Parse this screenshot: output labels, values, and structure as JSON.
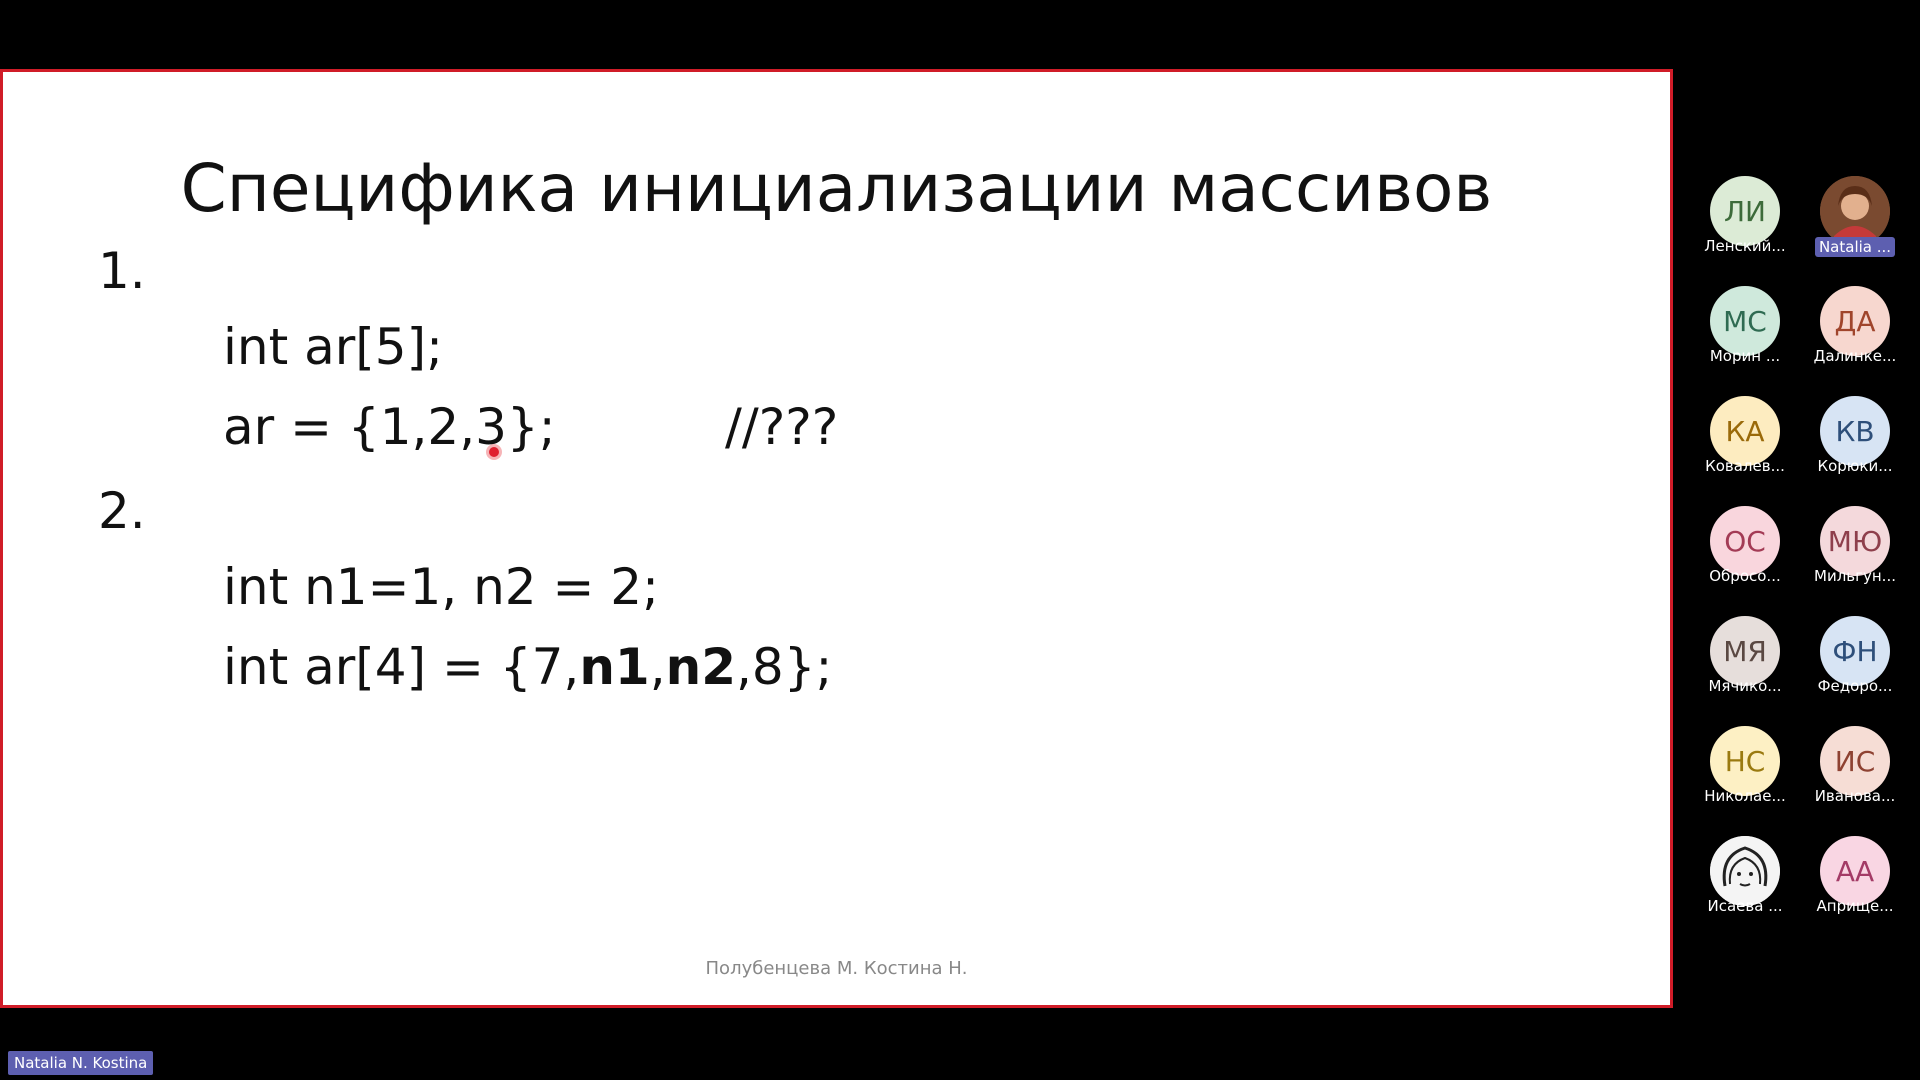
{
  "slide": {
    "title": "Специфика инициализации массивов",
    "item1_number": "1.",
    "item1_line1": "int ar[5];",
    "item1_line2": "ar = {1,2,3};",
    "item1_comment": "//???",
    "item2_number": "2.",
    "item2_line1": "int n1=1, n2 = 2;",
    "item2_line2_prefix": "int ar[4] = {7,",
    "item2_line2_bold1": "n1",
    "item2_line2_sep": ",",
    "item2_line2_bold2": "n2",
    "item2_line2_suffix": ",8};",
    "footer": "Полубенцева М. Костина Н."
  },
  "participants": [
    {
      "initials": "ЛИ",
      "name": "Ленский...",
      "bg": "#dcebd6",
      "fg": "#3d6b3a"
    },
    {
      "initials": "",
      "name": "Natalia ...",
      "bg": "#8a5a3c",
      "fg": "#ffffff",
      "photo": true,
      "active": true
    },
    {
      "initials": "МС",
      "name": "Морин ...",
      "bg": "#cfe9dc",
      "fg": "#2f6b52"
    },
    {
      "initials": "ДА",
      "name": "Далинке...",
      "bg": "#f7d7cf",
      "fg": "#a0452c"
    },
    {
      "initials": "КА",
      "name": "Ковалев...",
      "bg": "#fdecc0",
      "fg": "#9a6a0a"
    },
    {
      "initials": "КВ",
      "name": "Корюки...",
      "bg": "#d7e4f4",
      "fg": "#2e4f7a"
    },
    {
      "initials": "ОС",
      "name": "Обросо...",
      "bg": "#f9d6dd",
      "fg": "#a33b55"
    },
    {
      "initials": "МЮ",
      "name": "Мильгун...",
      "bg": "#f4d9dc",
      "fg": "#8e3f4c"
    },
    {
      "initials": "МЯ",
      "name": "Мячико...",
      "bg": "#e6dedb",
      "fg": "#5a4842"
    },
    {
      "initials": "ФН",
      "name": "Федоро...",
      "bg": "#d7e4f4",
      "fg": "#2e4f7a"
    },
    {
      "initials": "НС",
      "name": "Николае...",
      "bg": "#fdf0c4",
      "fg": "#9a7a10"
    },
    {
      "initials": "ИС",
      "name": "Иванова...",
      "bg": "#f6ddd5",
      "fg": "#8e4232"
    },
    {
      "initials": "",
      "name": "Исаева ...",
      "bg": "#f4f4f4",
      "fg": "#222222",
      "sketch": true
    },
    {
      "initials": "АА",
      "name": "Априще...",
      "bg": "#f9d6e3",
      "fg": "#a33b66"
    }
  ],
  "speaker_label": "Natalia N. Kostina"
}
